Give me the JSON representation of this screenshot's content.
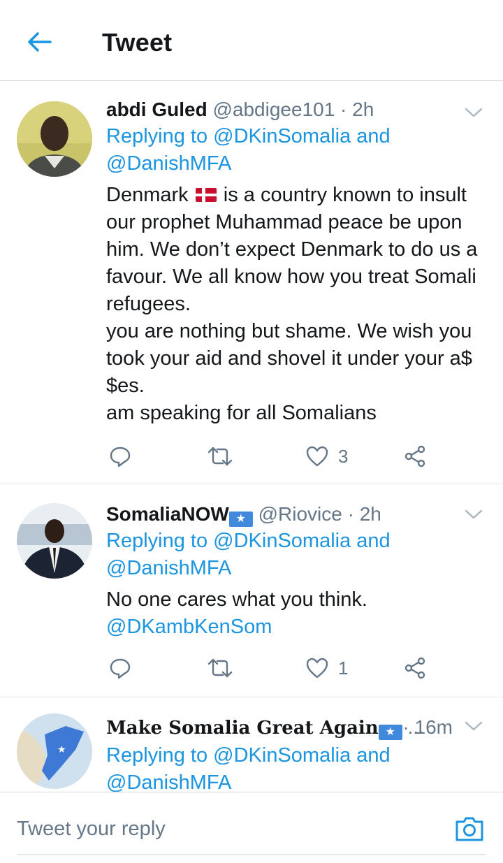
{
  "header": {
    "title": "Tweet"
  },
  "tweets": [
    {
      "name": "abdi Guled",
      "handle": "@abdigee101",
      "time": "· 2h",
      "reply_prefix": "Replying to",
      "reply_to_1": "@DKinSomalia",
      "reply_and": "and",
      "reply_to_2": "@DanishMFA",
      "body_start": "Denmark",
      "body_line1_rest": "is a country known to insult",
      "body_line2": "our prophet Muhammad peace be upon",
      "body_line3": "him. We don’t expect Denmark to do us a",
      "body_line4": "favour. We all know how you treat Somali",
      "body_line5": "refugees.",
      "body_line6": "you are nothing but shame. We wish you",
      "body_line7": "took your aid and shovel it under your a$",
      "body_line8": "$es.",
      "body_line9": "am speaking for all Somalians",
      "likes": "3"
    },
    {
      "name": "SomaliaNOW",
      "handle": "@Riovice",
      "time": "· 2h",
      "reply_prefix": "Replying to",
      "reply_to_1": "@DKinSomalia",
      "reply_and": "and",
      "reply_to_2": "@DanishMFA",
      "body_line1": "No one cares what you think.",
      "body_mention": "@DKambKenSom",
      "likes": "1"
    },
    {
      "name": "Make Somalia Great Again",
      "ellipsis": "...",
      "time": "· 16m",
      "reply_prefix": "Replying to",
      "reply_to_1": "@DKinSomalia",
      "reply_and": "and",
      "reply_to_2": "@DanishMFA"
    }
  ],
  "reply_bar": {
    "placeholder": "Tweet your reply"
  },
  "colors": {
    "accent": "#1b95e0",
    "secondary_text": "#657786",
    "divider": "#e1e6ea"
  },
  "icons": [
    "back-arrow-icon",
    "chevron-down-icon",
    "reply-icon",
    "retweet-icon",
    "heart-icon",
    "share-icon",
    "camera-icon",
    "denmark-flag-icon",
    "somalia-flag-icon"
  ]
}
